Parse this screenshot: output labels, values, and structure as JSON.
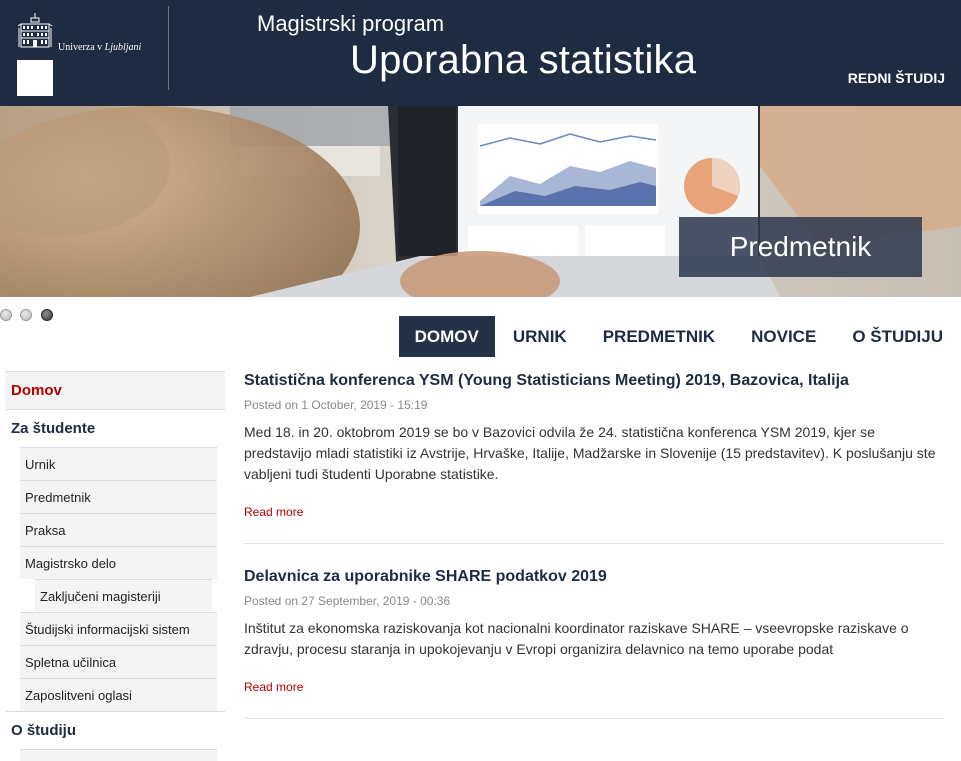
{
  "header": {
    "university_prefix": "Univerza v ",
    "university_city": "Ljubljani",
    "program_label": "Magistrski program",
    "program_title": "Uporabna statistika",
    "study_mode": "REDNI ŠTUDIJ",
    "background_color": "#1f2b40"
  },
  "banner": {
    "caption": "Predmetnik",
    "slide_count": 3,
    "active_slide": 3
  },
  "main_nav": {
    "items": [
      {
        "label": "DOMOV",
        "active": true
      },
      {
        "label": "URNIK",
        "active": false
      },
      {
        "label": "PREDMETNIK",
        "active": false
      },
      {
        "label": "NOVICE",
        "active": false
      },
      {
        "label": "O ŠTUDIJU",
        "active": false
      }
    ]
  },
  "sidebar": {
    "home": "Domov",
    "students_section": "Za študente",
    "students_items": [
      "Urnik",
      "Predmetnik",
      "Praksa",
      "Magistrsko delo"
    ],
    "thesis_sub": "Zaključeni magisteriji",
    "students_items_after": [
      "Študijski informacijski sistem",
      "Spletna učilnica",
      "Zaposlitveni oglasi"
    ],
    "about_section": "O študiju",
    "active_color": "#b40000"
  },
  "posts": [
    {
      "title": "Statistična konferenca YSM (Young Statisticians Meeting) 2019, Bazovica, Italija",
      "meta": "Posted on 1 October, 2019 - 15:19",
      "body": "Med 18. in 20. oktobrom 2019 se bo v Bazovici odvila že 24. statistična konferenca YSM 2019, kjer se predstavijo mladi statistiki iz Avstrije, Hrvaške, Italije, Madžarske in Slovenije (15 predstavitev). K poslušanju ste vabljeni tudi študenti Uporabne statistike.",
      "read_more": "Read more"
    },
    {
      "title": "Delavnica za uporabnike SHARE podatkov 2019",
      "meta": "Posted on 27 September, 2019 - 00:36",
      "body": "Inštitut za ekonomska raziskovanja kot nacionalni koordinator raziskave SHARE – vseevropske raziskave o zdravju, procesu staranja in upokojevanju v Evropi organizira delavnico na temo uporabe podat",
      "read_more": "Read more"
    }
  ]
}
